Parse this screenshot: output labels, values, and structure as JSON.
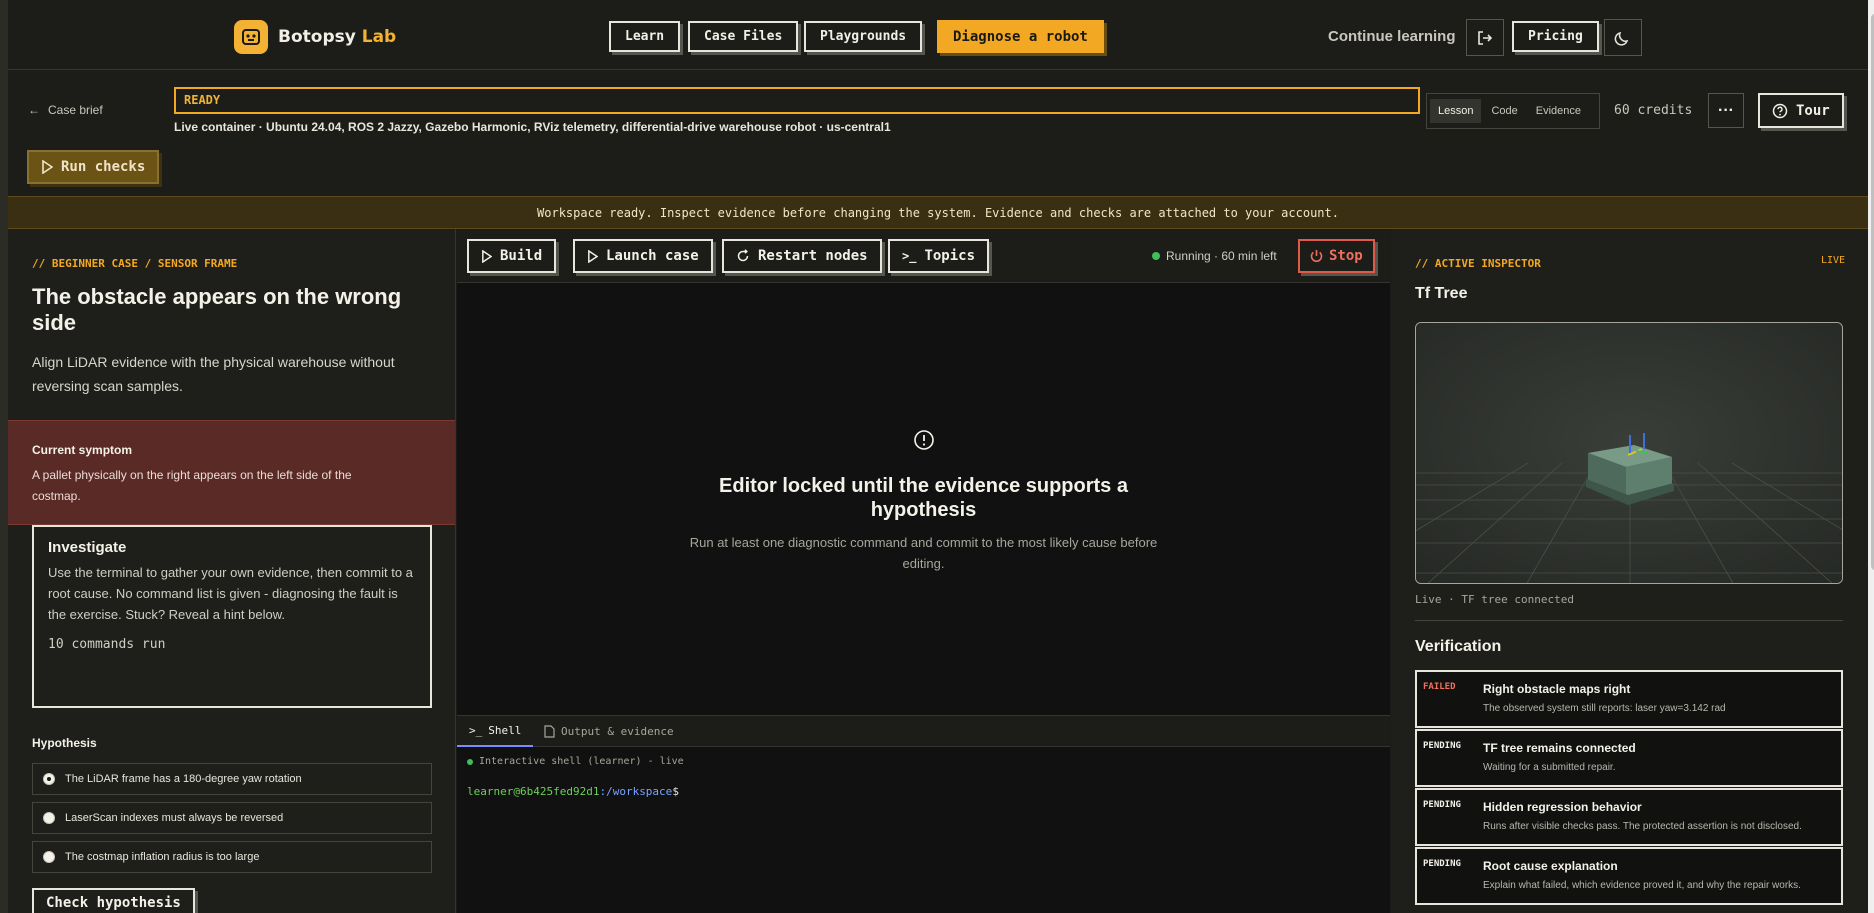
{
  "brand": {
    "name": "Botopsy",
    "accent": "Lab"
  },
  "nav": {
    "learn": "Learn",
    "case_files": "Case Files",
    "playgrounds": "Playgrounds",
    "diagnose": "Diagnose a robot",
    "continue": "Continue learning",
    "pricing": "Pricing"
  },
  "subbar": {
    "back": "Case brief",
    "status": "READY",
    "container": "Live container · Ubuntu 24.04, ROS 2 Jazzy, Gazebo Harmonic, RViz telemetry, differential-drive warehouse robot · us-central1",
    "views": [
      "Lesson",
      "Code",
      "Evidence"
    ],
    "credits": "60 credits",
    "more": "···",
    "tour": "Tour",
    "run_checks": "Run checks"
  },
  "banner": "Workspace ready. Inspect evidence before changing the system. Evidence and checks are attached to your account.",
  "case": {
    "eyebrow": "// BEGINNER CASE / SENSOR FRAME",
    "title": "The obstacle appears on the wrong side",
    "description": "Align LiDAR evidence with the physical warehouse without reversing scan samples.",
    "symptom_title": "Current symptom",
    "symptom_text": "A pallet physically on the right appears on the left side of the costmap.",
    "investigate_title": "Investigate",
    "investigate_text": "Use the terminal to gather your own evidence, then commit to a root cause. No command list is given - diagnosing the fault is the exercise. Stuck? Reveal a hint below.",
    "commands_run": "10 commands run",
    "hypothesis_title": "Hypothesis",
    "hypotheses": [
      "The LiDAR frame has a 180-degree yaw rotation",
      "LaserScan indexes must always be reversed",
      "The costmap inflation radius is too large"
    ],
    "check_button": "Check hypothesis"
  },
  "toolbar": {
    "build": "Build",
    "launch": "Launch case",
    "restart": "Restart nodes",
    "topics": "Topics",
    "running": "Running · 60 min left",
    "stop": "Stop"
  },
  "editor": {
    "locked_title": "Editor locked until the evidence supports a hypothesis",
    "locked_sub": "Run at least one diagnostic command and commit to the most likely cause before editing."
  },
  "shell": {
    "tab_shell": "Shell",
    "tab_output": "Output & evidence",
    "status": "Interactive shell (learner) - live",
    "user": "learner@6b425fed92d1",
    "path": ":/workspace",
    "sign": "$"
  },
  "inspector": {
    "eyebrow": "// ACTIVE INSPECTOR",
    "live": "LIVE",
    "title": "Tf Tree",
    "caption": "Live · TF tree connected",
    "verification_title": "Verification",
    "checks": [
      {
        "status": "FAILED",
        "title": "Right obstacle maps right",
        "desc": "The observed system still reports: laser yaw=3.142 rad"
      },
      {
        "status": "PENDING",
        "title": "TF tree remains connected",
        "desc": "Waiting for a submitted repair."
      },
      {
        "status": "PENDING",
        "title": "Hidden regression behavior",
        "desc": "Runs after visible checks pass. The protected assertion is not disclosed."
      },
      {
        "status": "PENDING",
        "title": "Root cause explanation",
        "desc": "Explain what failed, which evidence proved it, and why the repair works."
      }
    ]
  },
  "colors": {
    "accent": "#f3a824",
    "failed": "#f07060",
    "running": "#3fbf5a",
    "symptom_bg": "#5a2a26"
  }
}
